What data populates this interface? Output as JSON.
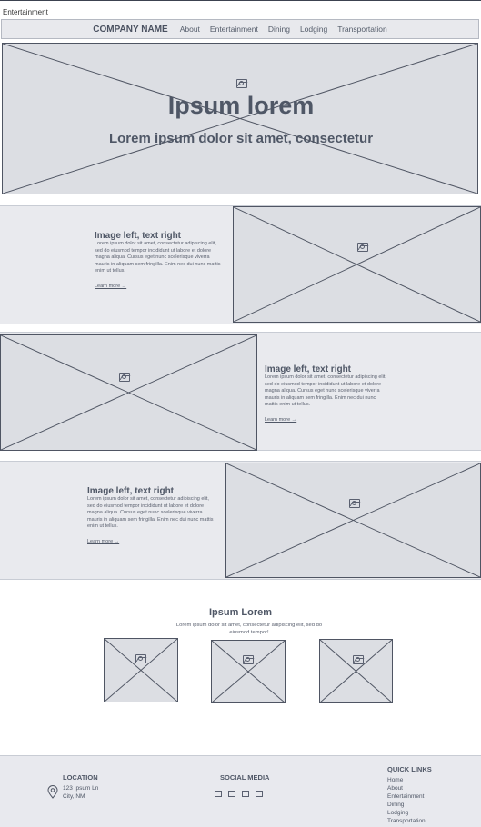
{
  "page_label": "Entertainment",
  "nav": {
    "brand": "COMPANY NAME",
    "links": [
      "About",
      "Entertainment",
      "Dining",
      "Lodging",
      "Transportation"
    ]
  },
  "hero": {
    "title": "Ipsum lorem",
    "subtitle": "Lorem ipsum dolor sit amet, consectetur"
  },
  "features": [
    {
      "title": "Image left, text right",
      "body": "Lorem ipsum dolor sit amet, consectetur adipiscing elit, sed do eiusmod tempor incididunt ut labore et dolore magna aliqua. Cursus eget nunc scelerisque viverra mauris in aliquam sem fringilla. Enim nec dui nunc mattis enim ut tellus.",
      "link": "Learn more →"
    },
    {
      "title": "Image left, text right",
      "body": "Lorem ipsum dolor sit amet, consectetur adipiscing elit, sed do eiusmod tempor incididunt ut labore et dolore magna aliqua. Cursus eget nunc scelerisque viverra mauris in aliquam sem fringilla. Enim nec dui nunc mattis enim ut tellus.",
      "link": "Learn more →"
    },
    {
      "title": "Image left, text right",
      "body": "Lorem ipsum dolor sit amet, consectetur adipiscing elit, sed do eiusmod tempor incididunt ut labore et dolore magna aliqua. Cursus eget nunc scelerisque viverra mauris in aliquam sem fringilla. Enim nec dui nunc mattis enim ut tellus.",
      "link": "Learn more →"
    }
  ],
  "gallery": {
    "title": "Ipsum Lorem",
    "subtitle": "Lorem ipsum dolor sit amet, consectetur adipiscing elit, sed do eiusmod tempor!"
  },
  "footer": {
    "location_title": "LOCATION",
    "address_line1": "123 Ipsum Ln",
    "address_line2": "City, NM",
    "social_title": "SOCIAL MEDIA",
    "quick_title": "QUICK LINKS",
    "quick_links": [
      "Home",
      "About",
      "Entertainment",
      "Dining",
      "Lodging",
      "Transportation"
    ]
  }
}
